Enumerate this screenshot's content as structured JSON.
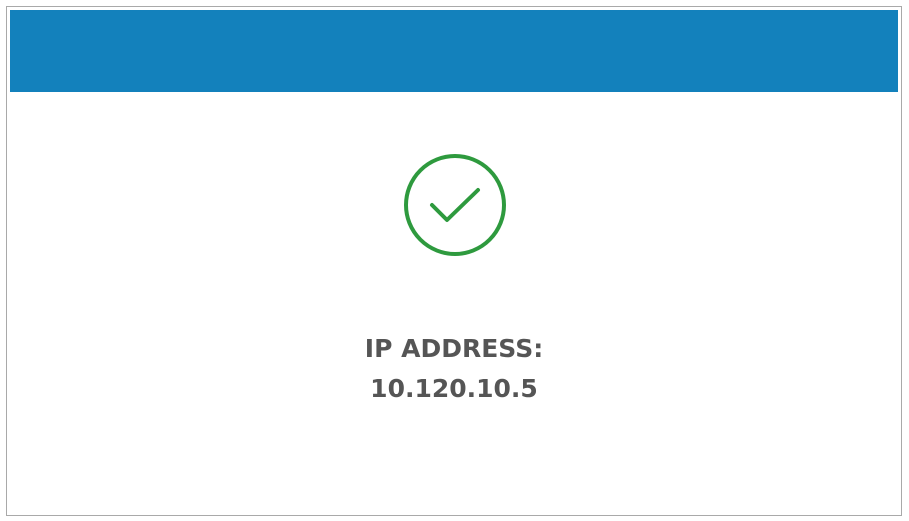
{
  "header": {
    "color": "#1381bc"
  },
  "status": {
    "icon": "check-circle-icon",
    "color": "#2e9a3e"
  },
  "ip": {
    "label": "IP ADDRESS:",
    "value": "10.120.10.5",
    "text_color": "#555555"
  }
}
